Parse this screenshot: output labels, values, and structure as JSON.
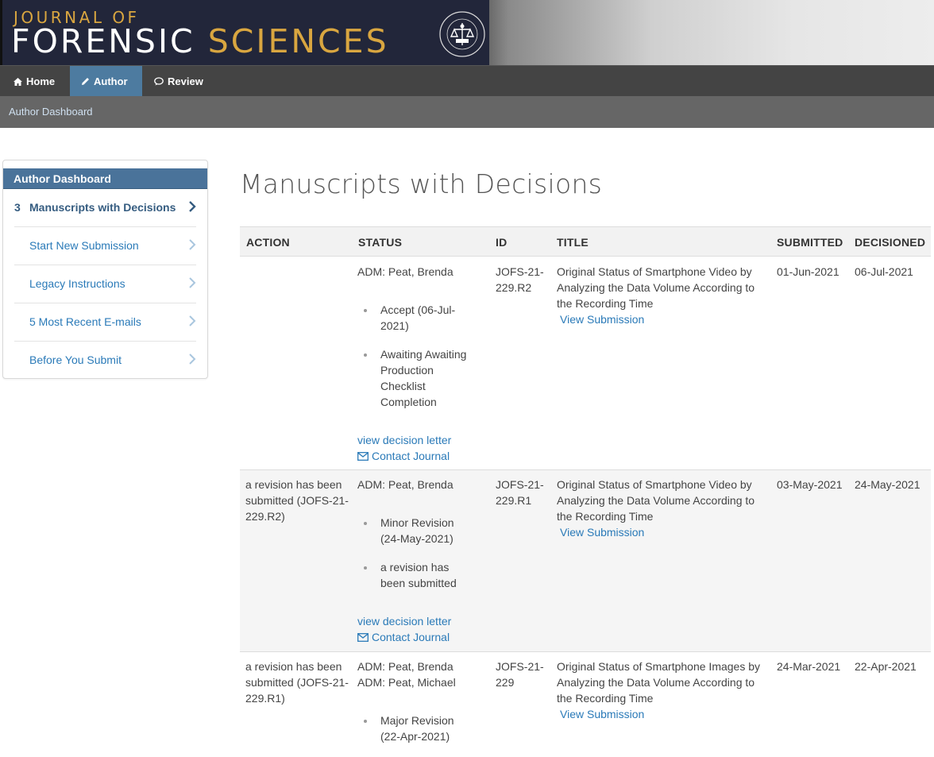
{
  "banner": {
    "journal_of": "JOURNAL OF",
    "word1": "FORENSIC",
    "word2": "SCIENCES",
    "seal_icon": "academy-seal-icon"
  },
  "nav": {
    "home": "Home",
    "author": "Author",
    "review": "Review",
    "active": "Author"
  },
  "breadcrumb": "Author Dashboard",
  "sidebar": {
    "title": "Author Dashboard",
    "items": [
      {
        "count": "3",
        "label": "Manuscripts with Decisions",
        "active": true
      },
      {
        "count": "",
        "label": "Start New Submission"
      },
      {
        "count": "",
        "label": "Legacy Instructions"
      },
      {
        "count": "",
        "label": "5 Most Recent E-mails"
      },
      {
        "count": "",
        "label": "Before You Submit"
      }
    ]
  },
  "main": {
    "title": "Manuscripts with Decisions",
    "columns": [
      "ACTION",
      "STATUS",
      "ID",
      "TITLE",
      "SUBMITTED",
      "DECISIONED"
    ],
    "rows": [
      {
        "action": "",
        "admins": [
          "ADM: Peat, Brenda"
        ],
        "statuses": [
          "Accept (06-Jul-2021)",
          "Awaiting Awaiting Production Checklist Completion"
        ],
        "decision_link": "view decision letter",
        "contact_link": "Contact Journal",
        "id": "JOFS-21-229.R2",
        "title": "Original Status of Smartphone Video by Analyzing the Data Volume According to the Recording Time",
        "view_link": "View Submission",
        "submitted": "01-Jun-2021",
        "decisioned": "06-Jul-2021"
      },
      {
        "action": "a revision has been submitted (JOFS-21-229.R2)",
        "admins": [
          "ADM: Peat, Brenda"
        ],
        "statuses": [
          "Minor Revision (24-May-2021)",
          "a revision has been submitted"
        ],
        "decision_link": "view decision letter",
        "contact_link": "Contact Journal",
        "id": "JOFS-21-229.R1",
        "title": "Original Status of Smartphone Video by Analyzing the Data Volume According to the Recording Time",
        "view_link": "View Submission",
        "submitted": "03-May-2021",
        "decisioned": "24-May-2021"
      },
      {
        "action": "a revision has been submitted (JOFS-21-229.R1)",
        "admins": [
          "ADM: Peat, Brenda",
          "ADM: Peat, Michael"
        ],
        "statuses": [
          "Major Revision (22-Apr-2021)"
        ],
        "id": "JOFS-21-229",
        "title": "Original Status of Smartphone Images by Analyzing the Data Volume According to the Recording Time",
        "view_link": "View Submission",
        "submitted": "24-Mar-2021",
        "decisioned": "22-Apr-2021"
      }
    ]
  }
}
